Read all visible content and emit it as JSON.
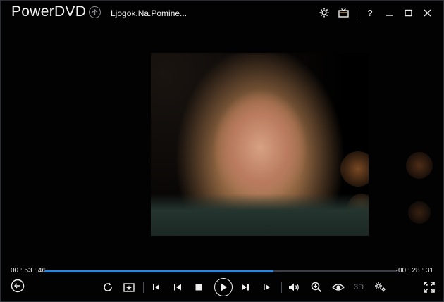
{
  "app": {
    "title": "PowerDVD",
    "media_title": "Ljogok.Na.Pomine..."
  },
  "titlebar": {
    "icons": [
      "gear-icon",
      "tv-mode-icon",
      "help-icon",
      "minimize-icon",
      "maximize-icon",
      "close-icon"
    ],
    "help_label": "?"
  },
  "player": {
    "elapsed": "00 : 53 : 46",
    "remaining": "-00 : 28 : 31",
    "progress_fraction": 0.65,
    "three_d_label": "3D",
    "accent_color": "#2a86e0"
  },
  "controls": {
    "icons": [
      "back-icon",
      "repeat-icon",
      "snapshot-icon",
      "previous-chapter-icon",
      "step-back-icon",
      "stop-icon",
      "play-icon",
      "step-forward-icon",
      "next-chapter-icon",
      "volume-icon",
      "zoom-icon",
      "eye-icon",
      "3d-label",
      "settings-icon",
      "fullscreen-icon"
    ]
  }
}
